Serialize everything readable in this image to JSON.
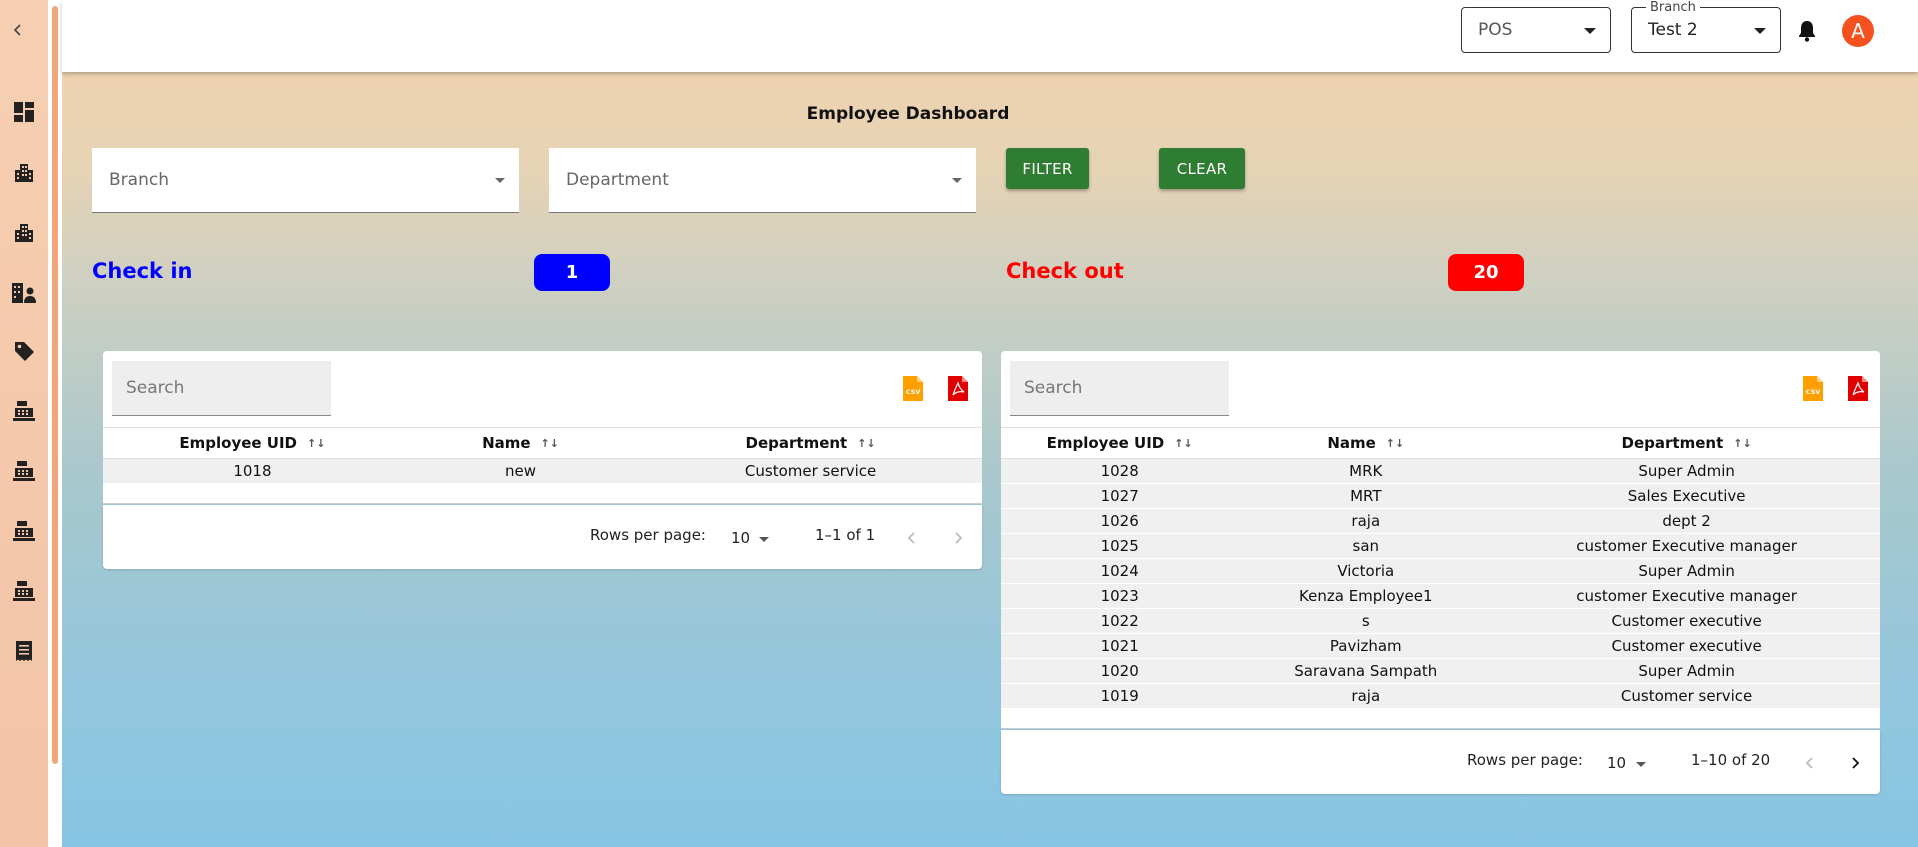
{
  "header": {
    "pos_select": {
      "value": "POS"
    },
    "branch_select": {
      "legend": "Branch",
      "value": "Test 2"
    },
    "avatar_initial": "A"
  },
  "page": {
    "title": "Employee Dashboard"
  },
  "filters": {
    "branch_placeholder": "Branch",
    "department_placeholder": "Department",
    "filter_label": "FILTER",
    "clear_label": "CLEAR"
  },
  "stats": {
    "checkin_label": "Check in",
    "checkin_count": "1",
    "checkout_label": "Check out",
    "checkout_count": "20",
    "colors": {
      "checkin": "#0000ff",
      "checkout": "#ff0000"
    }
  },
  "sidebar": {
    "icons": [
      "dashboard-icon",
      "building-icon",
      "building-icon",
      "building-users-icon",
      "tag-icon",
      "cash-register-icon",
      "cash-register-icon",
      "cash-register-icon",
      "cash-register-icon",
      "receipt-list-icon"
    ]
  },
  "checkin_table": {
    "search_placeholder": "Search",
    "columns": [
      "Employee UID",
      "Name",
      "Department"
    ],
    "rows": [
      [
        "1018",
        "new",
        "Customer service"
      ]
    ],
    "rows_per_page_label": "Rows per page:",
    "rows_per_page": "10",
    "range": "1–1 of 1"
  },
  "checkout_table": {
    "search_placeholder": "Search",
    "columns": [
      "Employee UID",
      "Name",
      "Department"
    ],
    "rows": [
      [
        "1028",
        "MRK",
        "Super Admin"
      ],
      [
        "1027",
        "MRT",
        "Sales Executive"
      ],
      [
        "1026",
        "raja",
        "dept 2"
      ],
      [
        "1025",
        "san",
        "customer Executive manager"
      ],
      [
        "1024",
        "Victoria",
        "Super Admin"
      ],
      [
        "1023",
        "Kenza Employee1",
        "customer Executive manager"
      ],
      [
        "1022",
        "s",
        "Customer executive"
      ],
      [
        "1021",
        "Pavizham",
        "Customer executive"
      ],
      [
        "1020",
        "Saravana Sampath",
        "Super Admin"
      ],
      [
        "1019",
        "raja",
        "Customer service"
      ]
    ],
    "rows_per_page_label": "Rows per page:",
    "rows_per_page": "10",
    "range": "1–10 of 20"
  }
}
